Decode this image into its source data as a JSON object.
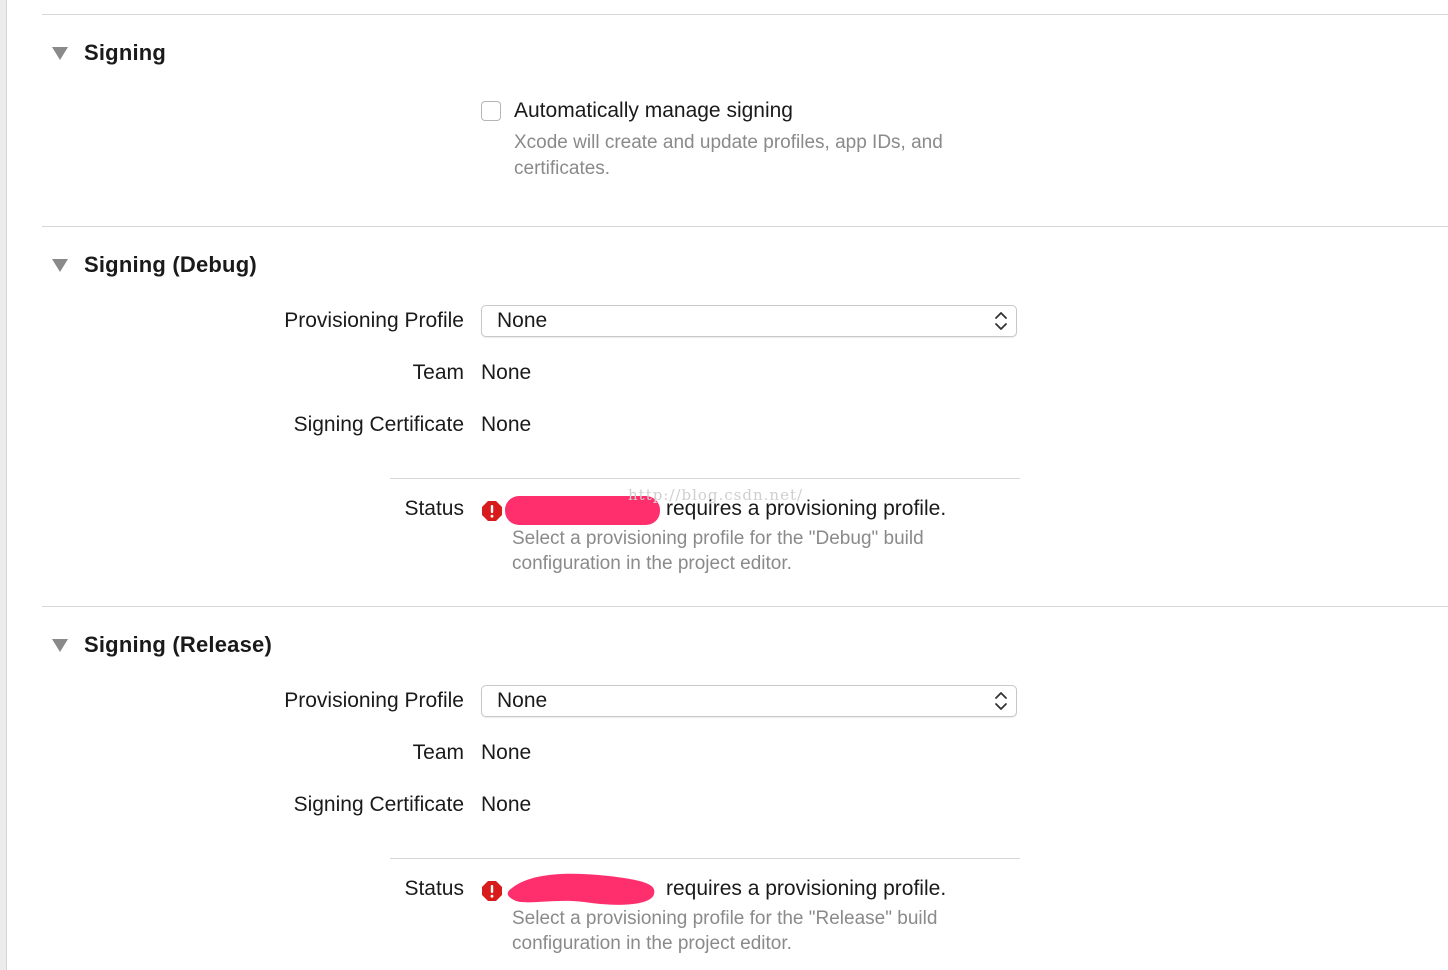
{
  "signing": {
    "title": "Signing",
    "auto_manage_label": "Automatically manage signing",
    "auto_manage_checked": false,
    "help_line1": "Xcode will create and update profiles, app IDs, and",
    "help_line2": "certificates."
  },
  "debug": {
    "title": "Signing (Debug)",
    "provisioning_label": "Provisioning Profile",
    "provisioning_value": "None",
    "team_label": "Team",
    "team_value": "None",
    "certificate_label": "Signing Certificate",
    "certificate_value": "None",
    "status_label": "Status",
    "status_message": "requires a provisioning profile.",
    "status_help_line1": "Select a provisioning profile for the \"Debug\" build",
    "status_help_line2": "configuration in the project editor."
  },
  "release": {
    "title": "Signing (Release)",
    "provisioning_label": "Provisioning Profile",
    "provisioning_value": "None",
    "team_label": "Team",
    "team_value": "None",
    "certificate_label": "Signing Certificate",
    "certificate_value": "None",
    "status_label": "Status",
    "status_message": "requires a provisioning profile.",
    "status_help_line1": "Select a provisioning profile for the \"Release\" build",
    "status_help_line2": "configuration in the project editor."
  },
  "watermark": "http://blog.csdn.net/",
  "colors": {
    "error_red": "#d81b1b",
    "redaction_pink": "#ff2f6e",
    "help_gray": "#8a8a8a"
  }
}
